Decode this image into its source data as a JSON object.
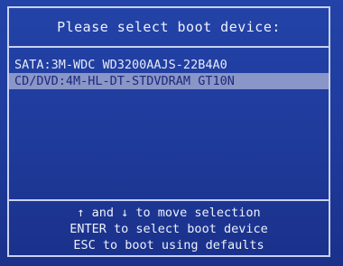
{
  "header": {
    "title": "Please select boot device:"
  },
  "devices": [
    {
      "label": "SATA:3M-WDC WD3200AAJS-22B4A0",
      "selected": false
    },
    {
      "label": "CD/DVD:4M-HL-DT-STDVDRAM GT10N",
      "selected": true
    }
  ],
  "help": {
    "line1": "↑ and ↓ to move selection",
    "line2": "ENTER to select boot device",
    "line3": "ESC to boot using defaults"
  },
  "colors": {
    "background": "#2343a8",
    "border": "#c9d2ee",
    "highlight": "#8a95c8",
    "text": "#e8ecf6"
  }
}
